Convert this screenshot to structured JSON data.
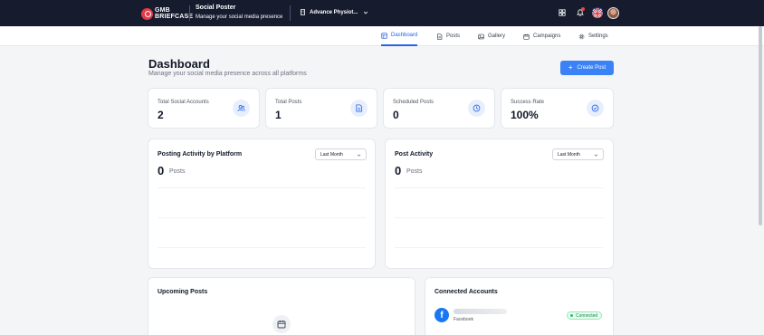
{
  "topbar": {
    "logo_line1": "GMB",
    "logo_line2": "BRIEFCASE",
    "app_title": "Social Poster",
    "app_subtitle": "Manage your social media presence",
    "business_name": "Advance Physiot...",
    "icons": [
      "grid-icon",
      "bell-icon",
      "uk-flag-icon",
      "user-avatar"
    ]
  },
  "nav": {
    "items": [
      {
        "label": "Dashboard",
        "icon": "layout-icon",
        "active": true
      },
      {
        "label": "Posts",
        "icon": "document-icon"
      },
      {
        "label": "Gallery",
        "icon": "image-icon"
      },
      {
        "label": "Campaigns",
        "icon": "calendar-icon"
      },
      {
        "label": "Settings",
        "icon": "gear-icon"
      }
    ]
  },
  "header": {
    "title": "Dashboard",
    "subtitle": "Manage your social media presence across all platforms",
    "create_label": "Create Post"
  },
  "stats": [
    {
      "label": "Total Social Accounts",
      "value": "2",
      "icon": "users-icon"
    },
    {
      "label": "Total Posts",
      "value": "1",
      "icon": "document-icon"
    },
    {
      "label": "Scheduled Posts",
      "value": "0",
      "icon": "clock-icon"
    },
    {
      "label": "Success Rate",
      "value": "100%",
      "icon": "check-circle-icon"
    }
  ],
  "charts": {
    "platform": {
      "title": "Posting Activity by Platform",
      "range": "Last Month",
      "count": "0",
      "unit": "Posts"
    },
    "activity": {
      "title": "Post Activity",
      "range": "Last Month",
      "count": "0",
      "unit": "Posts"
    }
  },
  "upcoming": {
    "title": "Upcoming Posts",
    "icon": "calendar-icon"
  },
  "connected": {
    "title": "Connected Accounts",
    "accounts": [
      {
        "platform": "Facebook",
        "status": "Connected",
        "icon": "facebook-icon"
      }
    ]
  },
  "colors": {
    "accent": "#3b82f6",
    "topbar": "#161b2e",
    "success": "#15803d"
  }
}
